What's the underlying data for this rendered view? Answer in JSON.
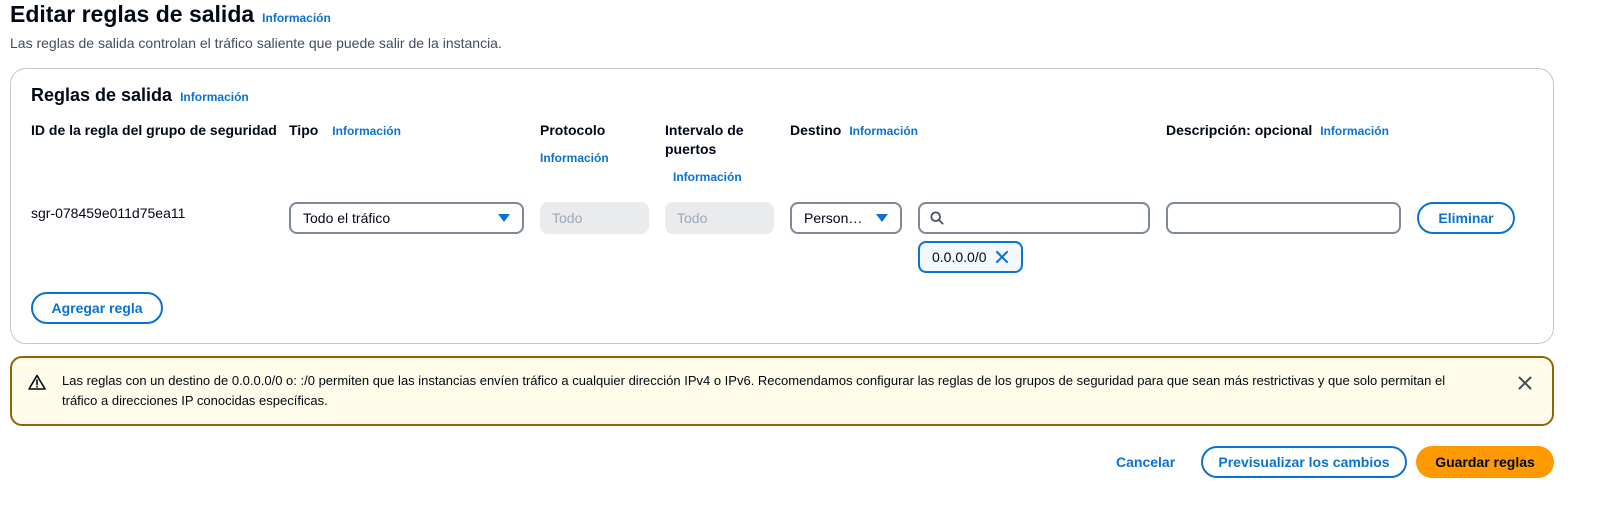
{
  "page": {
    "title": "Editar reglas de salida",
    "info": "Información",
    "description": "Las reglas de salida controlan el tráfico saliente que puede salir de la instancia."
  },
  "panel": {
    "title": "Reglas de salida",
    "info": "Información",
    "columns": {
      "rule_id": "ID de la regla del grupo de seguridad",
      "type": "Tipo",
      "protocol": "Protocolo",
      "port_range_line1": "Intervalo de",
      "port_range_line2": "puertos",
      "destination": "Destino",
      "description": "Descripción: opcional",
      "info": "Información"
    },
    "rule": {
      "id": "sgr-078459e011d75ea11",
      "type_value": "Todo el tráfico",
      "protocol_value": "Todo",
      "port_value": "Todo",
      "destination_type": "Person…",
      "destination_search_value": "",
      "destination_token": "0.0.0.0/0",
      "description_value": "",
      "delete_label": "Eliminar"
    },
    "add_rule_label": "Agregar regla"
  },
  "alert": {
    "text": "Las reglas con un destino de 0.0.0.0/0 o: :/0 permiten que las instancias envíen tráfico a cualquier dirección IPv4 o IPv6. Recomendamos configurar las reglas de los grupos de seguridad para que sean más restrictivas y que solo permitan el tráfico a direcciones IP conocidas específicas."
  },
  "footer": {
    "cancel_label": "Cancelar",
    "preview_label": "Previsualizar los cambios",
    "save_label": "Guardar reglas"
  },
  "colors": {
    "link": "#0972d3",
    "primary": "#ff9900",
    "warning_border": "#8d6605",
    "warning_bg": "#fffce9"
  },
  "icons": [
    "caret-down-icon",
    "search-icon",
    "remove-token-icon",
    "warning-icon",
    "dismiss-icon"
  ]
}
